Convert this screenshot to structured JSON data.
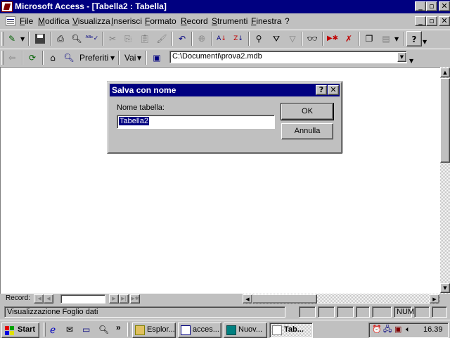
{
  "window": {
    "title": "Microsoft Access - [Tabella2 : Tabella]",
    "min_glyph": "_",
    "max_glyph": "▫",
    "close_glyph": "✕"
  },
  "menu": {
    "items": [
      "File",
      "Modifica",
      "Visualizza",
      "Inserisci",
      "Formato",
      "Record",
      "Strumenti",
      "Finestra",
      "?"
    ]
  },
  "web_toolbar": {
    "favorites_label": "Preferiti",
    "goto_label": "Vai",
    "address_value": "C:\\Documenti\\prova2.mdb"
  },
  "dialog": {
    "title": "Salva con nome",
    "help_glyph": "?",
    "close_glyph": "✕",
    "field_label": "Nome tabella:",
    "field_value": "Tabella2",
    "ok_label": "OK",
    "cancel_label": "Annulla"
  },
  "record_nav": {
    "label": "Record:",
    "current_value": ""
  },
  "status": {
    "message": "Visualizzazione Foglio dati",
    "num_indicator": "NUM"
  },
  "taskbar": {
    "start_label": "Start",
    "chevron": "»",
    "tasks": [
      {
        "label": "Esplor...",
        "active": false
      },
      {
        "label": "acces...",
        "active": false
      },
      {
        "label": "Nuov...",
        "active": false
      },
      {
        "label": "Tab...",
        "active": true
      }
    ],
    "clock": "16.39"
  },
  "colors": {
    "title_active": "#000080",
    "face": "#c0c0c0",
    "window_bg": "#ffffff"
  }
}
